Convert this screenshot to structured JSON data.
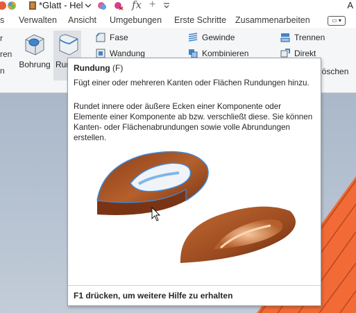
{
  "titlebar": {
    "document_title": "*Glatt - Hel",
    "right_letter": "A"
  },
  "tabs": [
    {
      "label": "s"
    },
    {
      "label": "Verwalten"
    },
    {
      "label": "Ansicht"
    },
    {
      "label": "Umgebungen"
    },
    {
      "label": "Erste Schritte"
    },
    {
      "label": "Zusammenarbeiten"
    }
  ],
  "ribbon": {
    "left_cut": [
      "r",
      "ren",
      "n"
    ],
    "bohrung": "Bohrung",
    "rundung": "Run",
    "fase": "Fase",
    "wandung": "Wandung",
    "gewinde": "Gewinde",
    "kombinieren": "Kombinieren",
    "trennen": "Trennen",
    "direkt": "Direkt",
    "loeschen": "löschen"
  },
  "tooltip": {
    "title": "Rundung",
    "shortcut": "(F)",
    "summary": "Fügt einer oder mehreren Kanten oder Flächen Rundungen hinzu.",
    "description": "Rundet innere oder äußere Ecken einer Komponente oder Elemente einer Komponente ab bzw. verschließt diese. Sie können Kanten- oder Flächenabrundungen sowie volle Abrundungen erstellen.",
    "footer": "F1 drücken, um weitere Hilfe zu erhalten"
  },
  "colors": {
    "model_orange": "#f26a35",
    "part_brown": "#a0522d",
    "edge_highlight": "#3a8be0"
  }
}
